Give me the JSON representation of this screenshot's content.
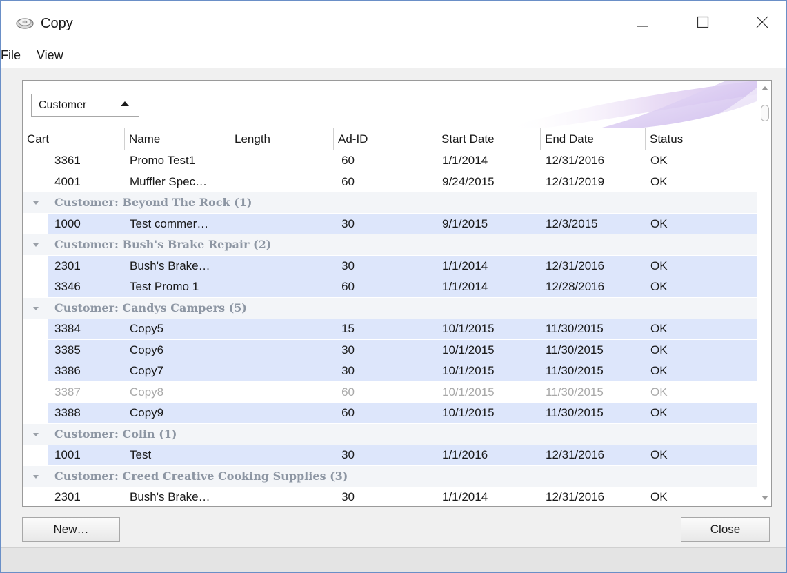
{
  "window": {
    "title": "Copy",
    "controls": {
      "minimize_icon": "minimize-icon",
      "maximize_icon": "maximize-icon",
      "close_icon": "close-icon"
    }
  },
  "menu": {
    "items": [
      "File",
      "View"
    ]
  },
  "group_panel": {
    "chip_label": "Customer"
  },
  "columns": [
    "Cart",
    "Name",
    "Length",
    "Ad-ID",
    "Start Date",
    "End Date",
    "Status"
  ],
  "rows": [
    {
      "type": "data",
      "state": "plain",
      "cart": "3361",
      "name": "Promo Test1",
      "length": "60",
      "adid": "",
      "start": "1/1/2014",
      "end": "12/31/2016",
      "status": "OK"
    },
    {
      "type": "data",
      "state": "plain",
      "cart": "4001",
      "name": "Muffler Spec…",
      "length": "60",
      "adid": "",
      "start": "9/24/2015",
      "end": "12/31/2019",
      "status": "OK"
    },
    {
      "type": "group",
      "label": "Customer: Beyond The Rock (1)"
    },
    {
      "type": "data",
      "state": "sel",
      "cart": "1000",
      "name": "Test commer…",
      "length": "30",
      "adid": "",
      "start": "9/1/2015",
      "end": "12/3/2015",
      "status": "OK"
    },
    {
      "type": "group",
      "label": "Customer: Bush's Brake Repair (2)"
    },
    {
      "type": "data",
      "state": "sel",
      "cart": "2301",
      "name": "Bush's Brake…",
      "length": "30",
      "adid": "",
      "start": "1/1/2014",
      "end": "12/31/2016",
      "status": "OK"
    },
    {
      "type": "data",
      "state": "sel",
      "cart": "3346",
      "name": "Test Promo 1",
      "length": "60",
      "adid": "",
      "start": "1/1/2014",
      "end": "12/28/2016",
      "status": "OK"
    },
    {
      "type": "group",
      "label": "Customer: Candys Campers (5)"
    },
    {
      "type": "data",
      "state": "sel",
      "cart": "3384",
      "name": "Copy5",
      "length": "15",
      "adid": "",
      "start": "10/1/2015",
      "end": "11/30/2015",
      "status": "OK"
    },
    {
      "type": "data",
      "state": "sel",
      "cart": "3385",
      "name": "Copy6",
      "length": "30",
      "adid": "",
      "start": "10/1/2015",
      "end": "11/30/2015",
      "status": "OK"
    },
    {
      "type": "data",
      "state": "sel",
      "cart": "3386",
      "name": "Copy7",
      "length": "30",
      "adid": "",
      "start": "10/1/2015",
      "end": "11/30/2015",
      "status": "OK"
    },
    {
      "type": "data",
      "state": "dim",
      "cart": "3387",
      "name": "Copy8",
      "length": "60",
      "adid": "",
      "start": "10/1/2015",
      "end": "11/30/2015",
      "status": "OK"
    },
    {
      "type": "data",
      "state": "sel",
      "cart": "3388",
      "name": "Copy9",
      "length": "60",
      "adid": "",
      "start": "10/1/2015",
      "end": "11/30/2015",
      "status": "OK"
    },
    {
      "type": "group",
      "label": "Customer: Colin (1)"
    },
    {
      "type": "data",
      "state": "sel",
      "cart": "1001",
      "name": "Test",
      "length": "30",
      "adid": "",
      "start": "1/1/2016",
      "end": "12/31/2016",
      "status": "OK"
    },
    {
      "type": "group",
      "label": "Customer: Creed Creative Cooking Supplies (3)"
    },
    {
      "type": "data",
      "state": "plain",
      "cart": "2301",
      "name": "Bush's Brake…",
      "length": "30",
      "adid": "",
      "start": "1/1/2014",
      "end": "12/31/2016",
      "status": "OK"
    }
  ],
  "buttons": {
    "new_label": "New…",
    "close_label": "Close"
  },
  "colors": {
    "selected_row": "#dde6fb",
    "group_label": "#8d96a3",
    "window_border": "#6a8fc7"
  }
}
